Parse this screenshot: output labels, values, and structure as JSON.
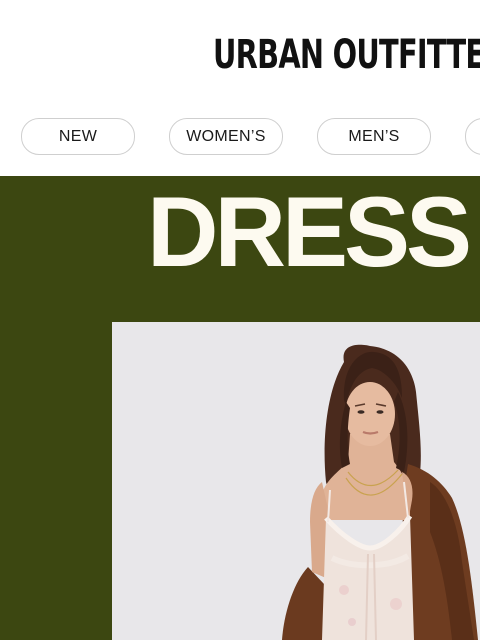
{
  "header": {
    "logo_text": "URBAN OUTFITTERS"
  },
  "nav": {
    "items": [
      {
        "label": "NEW"
      },
      {
        "label": "WOMEN’S"
      },
      {
        "label": "MEN’S"
      },
      {
        "label": ""
      }
    ]
  },
  "hero": {
    "title": "DRESS",
    "background_color": "#3c4711",
    "title_color": "#fdfaf0"
  },
  "icons": [
    "brand-logo"
  ]
}
